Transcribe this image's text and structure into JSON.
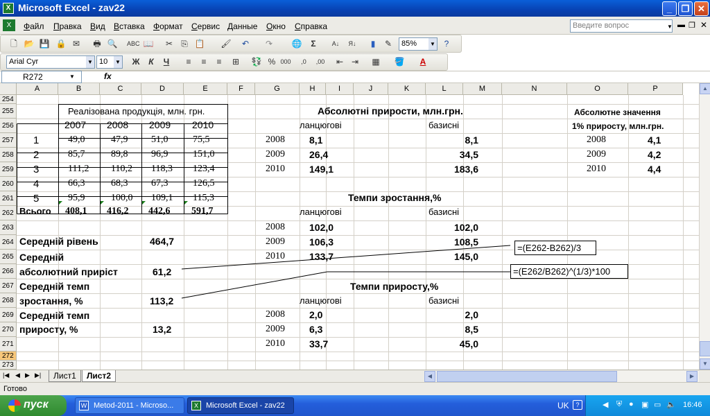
{
  "window": {
    "title": "Microsoft Excel - zav22"
  },
  "menu": [
    "Файл",
    "Правка",
    "Вид",
    "Вставка",
    "Формат",
    "Сервис",
    "Данные",
    "Окно",
    "Справка"
  ],
  "ask_placeholder": "Введите вопрос",
  "toolbar": {
    "zoom": "85%",
    "font": "Arial Cyr",
    "size": "10"
  },
  "name_box": "R272",
  "fx_label": "fx",
  "columns": [
    "A",
    "B",
    "C",
    "D",
    "E",
    "F",
    "G",
    "H",
    "I",
    "J",
    "K",
    "L",
    "M",
    "N",
    "O",
    "P"
  ],
  "rows": [
    "254",
    "255",
    "256",
    "257",
    "258",
    "259",
    "260",
    "261",
    "262",
    "263",
    "264",
    "265",
    "266",
    "267",
    "268",
    "269",
    "270",
    "271",
    "272",
    "273"
  ],
  "table1": {
    "header": "Реалізована продукція, млн. грн.",
    "years": [
      "2007",
      "2008",
      "2009",
      "2010"
    ],
    "data": [
      [
        "1",
        "49,0",
        "47,9",
        "51,0",
        "75,5"
      ],
      [
        "2",
        "85,7",
        "89,8",
        "96,9",
        "151,0"
      ],
      [
        "3",
        "111,2",
        "110,2",
        "118,3",
        "123,4"
      ],
      [
        "4",
        "66,3",
        "68,3",
        "67,3",
        "126,5"
      ],
      [
        "5",
        "95,9",
        "100,0",
        "109,1",
        "115,3"
      ]
    ],
    "total": [
      "Всього",
      "408,1",
      "416,2",
      "442,6",
      "591,7"
    ]
  },
  "stats": {
    "avg_level_label": "Середній рівень",
    "avg_level": "464,7",
    "abs_growth_l1": "Середній",
    "abs_growth_l2": "абсолютний приріст",
    "abs_growth": "61,2",
    "growth_rate_l1": "Середній темп",
    "growth_rate_l2": "зростання, %",
    "growth_rate": "113,2",
    "incr_rate_l1": "Середній темп",
    "incr_rate_l2": "приросту, %",
    "incr_rate": "13,2"
  },
  "abs": {
    "title": "Абсолютні прирости, млн.грн.",
    "chain": "ланцюгові",
    "base": "базисні",
    "rows": [
      [
        "2008",
        "8,1",
        "8,1"
      ],
      [
        "2009",
        "26,4",
        "34,5"
      ],
      [
        "2010",
        "149,1",
        "183,6"
      ]
    ]
  },
  "one_pct": {
    "title1": "Абсолютне значення",
    "title2": "1% приросту, млн.грн.",
    "rows": [
      [
        "2008",
        "4,1"
      ],
      [
        "2009",
        "4,2"
      ],
      [
        "2010",
        "4,4"
      ]
    ]
  },
  "growth": {
    "title": "Темпи зростання,%",
    "chain": "ланцюгові",
    "base": "базисні",
    "rows": [
      [
        "2008",
        "102,0",
        "102,0"
      ],
      [
        "2009",
        "106,3",
        "108,5"
      ],
      [
        "2010",
        "133,7",
        "145,0"
      ]
    ]
  },
  "increase": {
    "title": "Темпи приросту,%",
    "chain": "ланцюгові",
    "base": "базисні",
    "rows": [
      [
        "2008",
        "2,0",
        "2,0"
      ],
      [
        "2009",
        "6,3",
        "8,5"
      ],
      [
        "2010",
        "33,7",
        "45,0"
      ]
    ]
  },
  "formulas": {
    "f1": "=(E262-B262)/3",
    "f2": "=(E262/B262)^(1/3)*100"
  },
  "tabs": [
    "Лист1",
    "Лист2"
  ],
  "status": "Готово",
  "taskbar": {
    "start": "пуск",
    "tasks": [
      "Metod-2011 - Microso...",
      "Microsoft Excel - zav22"
    ],
    "lang": "UK",
    "clock": "16:46"
  }
}
